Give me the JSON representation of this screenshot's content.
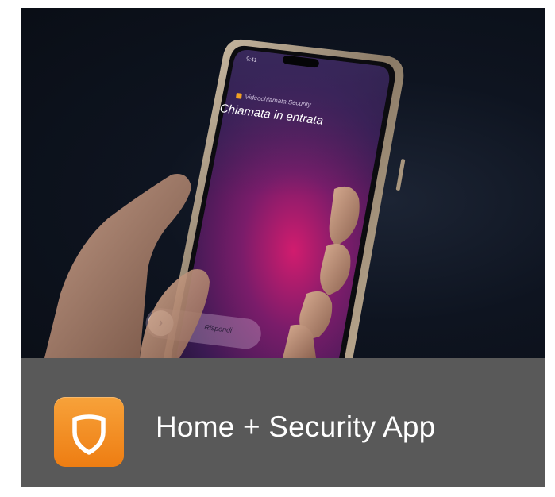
{
  "hero": {
    "status_time": "9:41",
    "caller_label": "Videochiamata Security",
    "incoming_title": "Chiamata in entrata",
    "answer_label": "Rispondi"
  },
  "footer": {
    "app_name": "Home + Security App",
    "icon": "shield-icon"
  },
  "colors": {
    "icon_orange": "#f08a1c",
    "footer_gray": "#595959",
    "screen_magenta": "#c2186f"
  }
}
